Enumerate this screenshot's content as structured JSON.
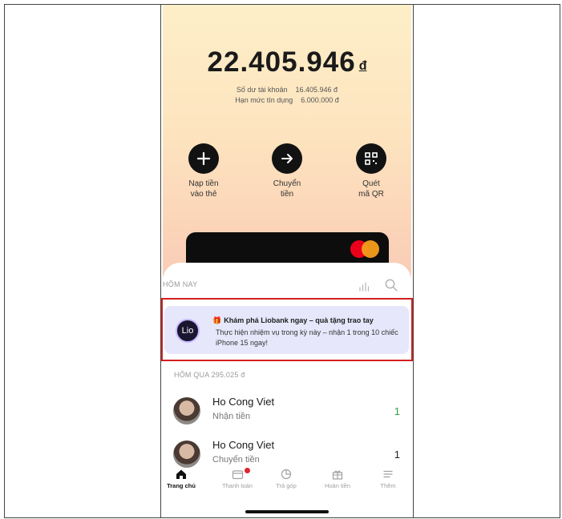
{
  "balance": {
    "amount": "22.405.946",
    "currency": "đ",
    "account_line": [
      "Số dư tài khoản",
      "16.405.946 đ"
    ],
    "credit_line": [
      "Hạn mức tín dụng",
      "6.000.000 đ"
    ]
  },
  "actions": [
    {
      "icon": "plus-icon",
      "label_1": "Nạp tiền",
      "label_2": "vào thẻ"
    },
    {
      "icon": "arrow-right-icon",
      "label_1": "Chuyển",
      "label_2": "tiền"
    },
    {
      "icon": "qr-code-icon",
      "label_1": "Quét",
      "label_2": "mã QR"
    }
  ],
  "colors": {
    "highlight_border": "#d31f1f",
    "promo_bg": "#e6e7fb",
    "income_green": "#2ea043",
    "card_bg": "#0d0d0d"
  },
  "feed": {
    "today_label": "HÔM NAY",
    "promo": {
      "logo": "Lio",
      "title": "Khám phá Liobank ngay – quà tặng trao tay",
      "text": "Thực hiện nhiệm vụ trong kỳ này – nhận 1 trong 10 chiếc iPhone 15 ngay!"
    },
    "yesterday_label": "HÔM QUA 295.025 đ",
    "transactions": [
      {
        "name": "Ho Cong Viet",
        "type": "Nhận tiền",
        "value": "1"
      },
      {
        "name": "Ho Cong Viet",
        "type": "Chuyển tiền",
        "value": "1"
      }
    ]
  },
  "tabs": [
    {
      "icon": "home-icon",
      "label": "Trang chủ"
    },
    {
      "icon": "wallet-icon",
      "label": "Thanh toán"
    },
    {
      "icon": "pie-chart-icon",
      "label": "Trả góp"
    },
    {
      "icon": "gift-icon",
      "label": "Hoàn tiền"
    },
    {
      "icon": "menu-icon",
      "label": "Thêm"
    }
  ]
}
